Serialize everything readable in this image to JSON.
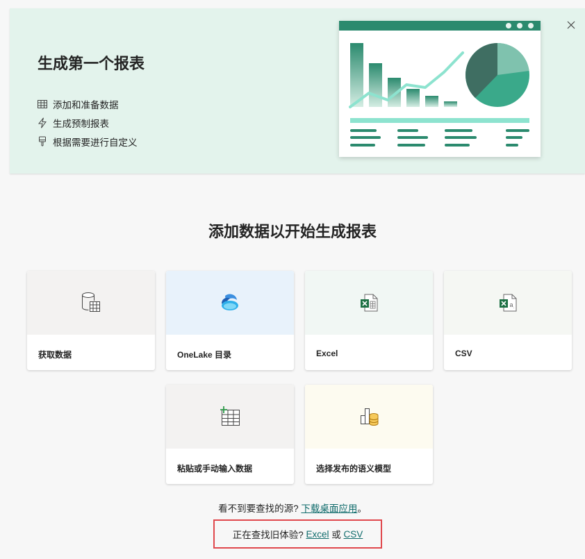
{
  "banner": {
    "title": "生成第一个报表",
    "features": [
      {
        "icon": "table-icon",
        "label": "添加和准备数据"
      },
      {
        "icon": "lightning-icon",
        "label": "生成预制报表"
      },
      {
        "icon": "paintbrush-icon",
        "label": "根据需要进行自定义"
      }
    ],
    "close_icon": "close-icon"
  },
  "main": {
    "heading": "添加数据以开始生成报表",
    "cards": [
      {
        "label": "获取数据",
        "icon": "database-table-icon",
        "bg": "#f3f2f1"
      },
      {
        "label": "OneLake 目录",
        "icon": "onelake-icon",
        "bg": "#e8f2fb"
      },
      {
        "label": "Excel",
        "icon": "excel-icon",
        "bg": "#f1f7f4"
      },
      {
        "label": "CSV",
        "icon": "csv-icon",
        "bg": "#f5f7f3"
      },
      {
        "label": "粘贴或手动输入数据",
        "icon": "table-add-icon",
        "bg": "#f3f2f1"
      },
      {
        "label": "选择发布的语义模型",
        "icon": "semantic-model-icon",
        "bg": "#fdfbf0"
      }
    ]
  },
  "footer": {
    "prefix": "看不到要查找的源?",
    "link": "下载桌面应用",
    "suffix": "。",
    "legacy_prefix": "正在查找旧体验?",
    "legacy_excel": "Excel",
    "legacy_or": "或",
    "legacy_csv": "CSV"
  },
  "colors": {
    "accent": "#2b8a6e",
    "link": "#0f6b6b",
    "highlight": "#e0474c"
  }
}
